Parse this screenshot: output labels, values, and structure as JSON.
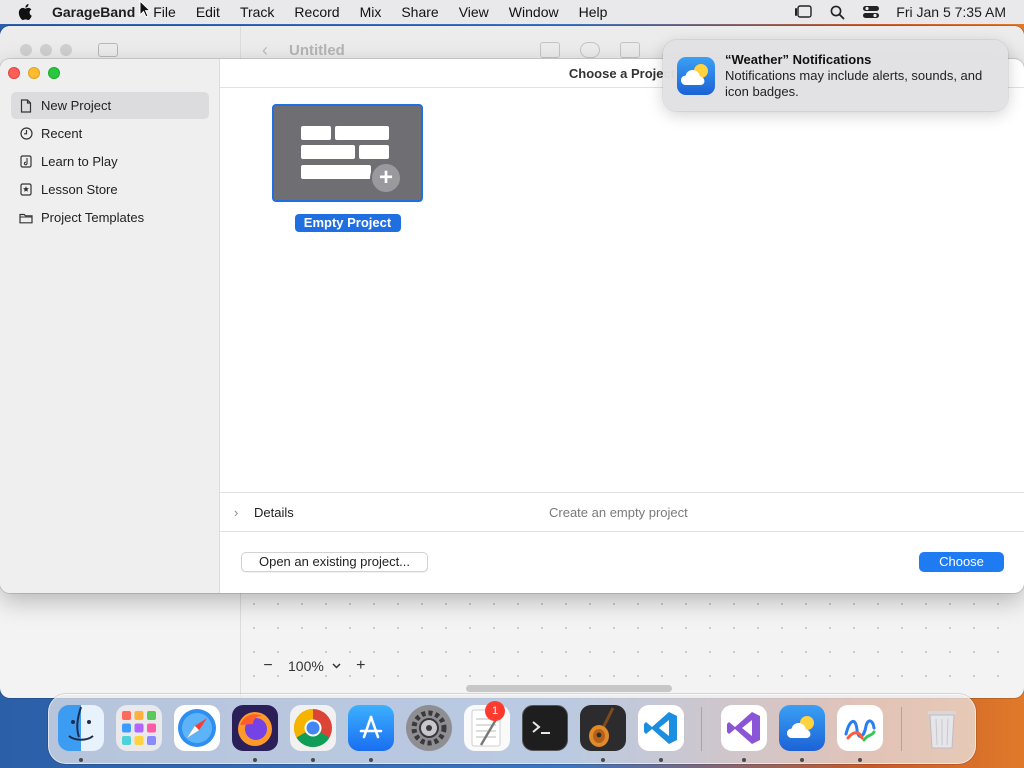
{
  "menubar": {
    "app_name": "GarageBand",
    "items": [
      "File",
      "Edit",
      "Track",
      "Record",
      "Mix",
      "Share",
      "View",
      "Window",
      "Help"
    ],
    "clock": "Fri Jan 5  7:35 AM"
  },
  "background_window": {
    "title": "Untitled",
    "zoom": {
      "value": "100%",
      "minus": "−",
      "plus": "+"
    }
  },
  "dialog": {
    "title": "Choose a Project",
    "sidebar": [
      {
        "label": "New Project",
        "icon": "document-icon",
        "active": true
      },
      {
        "label": "Recent",
        "icon": "clock-icon"
      },
      {
        "label": "Learn to Play",
        "icon": "learn-icon"
      },
      {
        "label": "Lesson Store",
        "icon": "star-icon"
      },
      {
        "label": "Project Templates",
        "icon": "folder-icon"
      }
    ],
    "project": {
      "label": "Empty Project"
    },
    "details": {
      "label": "Details",
      "description": "Create an empty project"
    },
    "buttons": {
      "open": "Open an existing project...",
      "choose": "Choose"
    }
  },
  "notification": {
    "title": "“Weather” Notifications",
    "body": "Notifications may include alerts, sounds, and icon badges."
  },
  "dock": {
    "badge": "1",
    "apps": [
      "Finder",
      "Launchpad",
      "Safari",
      "Firefox",
      "Chrome",
      "App Store",
      "System Settings",
      "TextEdit",
      "Terminal",
      "GarageBand",
      "Visual Studio Code",
      "Visual Studio",
      "Weather",
      "Freeform",
      "Trash"
    ]
  },
  "colors": {
    "accent": "#1f7bf2",
    "selection": "#1f6fe0",
    "close": "#ff5f57",
    "minimize": "#febc2e",
    "maximize": "#28c840"
  }
}
